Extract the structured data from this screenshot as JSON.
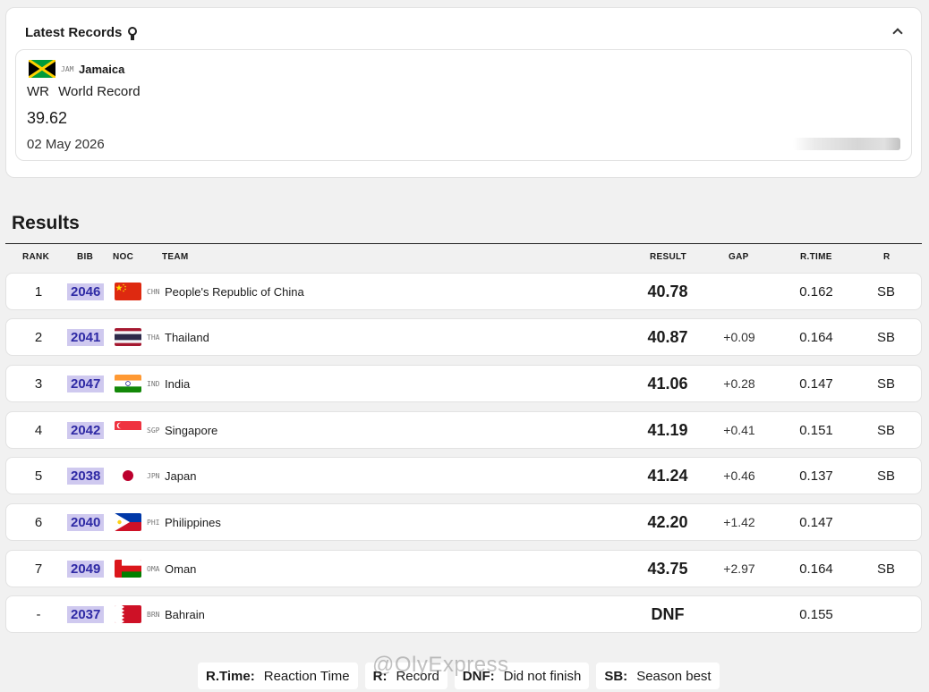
{
  "records": {
    "title": "Latest Records",
    "icon": "medal-icon",
    "latest": {
      "noc": "JAM",
      "country": "Jamaica",
      "record_abbr": "WR",
      "record_name": "World Record",
      "time": "39.62",
      "date": "02 May 2026"
    }
  },
  "results": {
    "title": "Results",
    "columns": {
      "rank": "RANK",
      "bib": "BIB",
      "noc": "NOC",
      "team": "TEAM",
      "result": "RESULT",
      "gap": "GAP",
      "rtime": "R.TIME",
      "r": "R"
    },
    "rows": [
      {
        "rank": "1",
        "bib": "2046",
        "noc": "CHN",
        "team": "People's Republic of China",
        "result": "40.78",
        "gap": "",
        "rtime": "0.162",
        "r": "SB"
      },
      {
        "rank": "2",
        "bib": "2041",
        "noc": "THA",
        "team": "Thailand",
        "result": "40.87",
        "gap": "+0.09",
        "rtime": "0.164",
        "r": "SB"
      },
      {
        "rank": "3",
        "bib": "2047",
        "noc": "IND",
        "team": "India",
        "result": "41.06",
        "gap": "+0.28",
        "rtime": "0.147",
        "r": "SB"
      },
      {
        "rank": "4",
        "bib": "2042",
        "noc": "SGP",
        "team": "Singapore",
        "result": "41.19",
        "gap": "+0.41",
        "rtime": "0.151",
        "r": "SB"
      },
      {
        "rank": "5",
        "bib": "2038",
        "noc": "JPN",
        "team": "Japan",
        "result": "41.24",
        "gap": "+0.46",
        "rtime": "0.137",
        "r": "SB"
      },
      {
        "rank": "6",
        "bib": "2040",
        "noc": "PHI",
        "team": "Philippines",
        "result": "42.20",
        "gap": "+1.42",
        "rtime": "0.147",
        "r": ""
      },
      {
        "rank": "7",
        "bib": "2049",
        "noc": "OMA",
        "team": "Oman",
        "result": "43.75",
        "gap": "+2.97",
        "rtime": "0.164",
        "r": "SB"
      },
      {
        "rank": "-",
        "bib": "2037",
        "noc": "BRN",
        "team": "Bahrain",
        "result": "DNF",
        "gap": "",
        "rtime": "0.155",
        "r": ""
      }
    ]
  },
  "legend": [
    {
      "key": "R.Time:",
      "value": "Reaction Time"
    },
    {
      "key": "R:",
      "value": "Record"
    },
    {
      "key": "DNF:",
      "value": "Did not finish"
    },
    {
      "key": "SB:",
      "value": "Season best"
    }
  ],
  "watermark": "@OlyExpress",
  "colors": {
    "bib_bg": "#cfc9ef",
    "bib_text": "#2f2aa5",
    "page_bg": "#f1f1f1"
  }
}
